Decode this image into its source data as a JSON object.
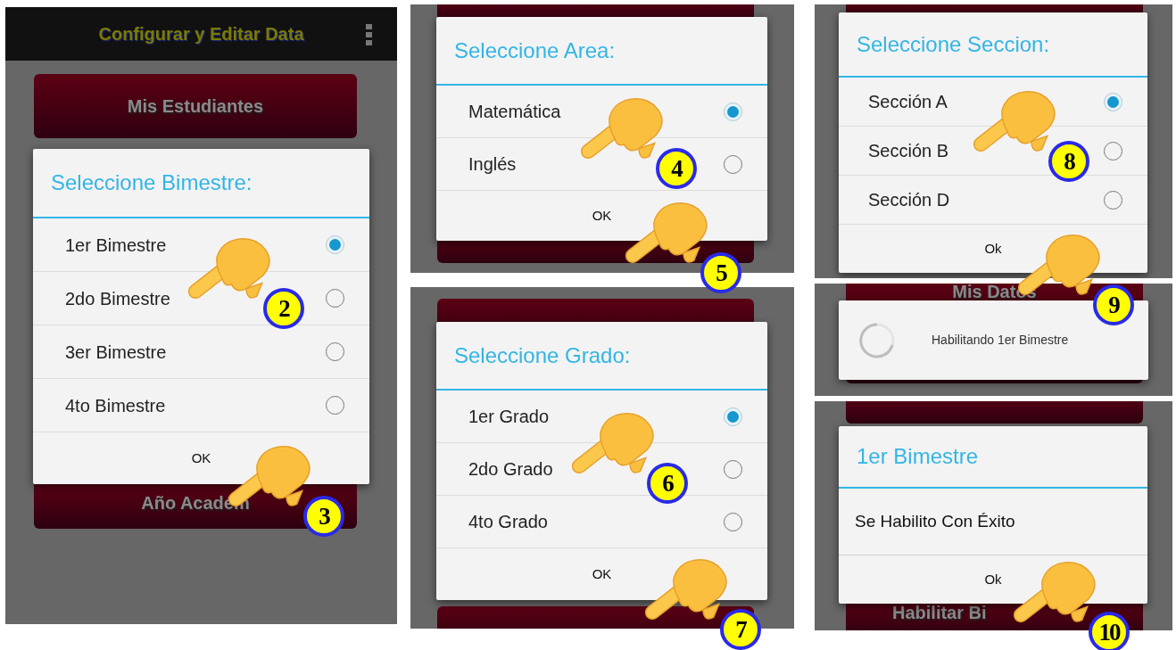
{
  "panels": [
    {
      "kind": "choice",
      "app_bar": {
        "title": "Configurar y Editar Data"
      },
      "backdrop": [
        {
          "label": "Mis Estudiantes"
        },
        {
          "label": "Año Académ"
        }
      ],
      "dialog": {
        "title": "Seleccione Bimestre:",
        "options": [
          {
            "label": "1er Bimestre",
            "selected": true
          },
          {
            "label": "2do Bimestre",
            "selected": false
          },
          {
            "label": "3er Bimestre",
            "selected": false
          },
          {
            "label": "4to Bimestre",
            "selected": false
          }
        ],
        "button": "OK"
      },
      "steps": [
        {
          "number": "2"
        },
        {
          "number": "3"
        }
      ]
    },
    {
      "kind": "choice",
      "dialog": {
        "title": "Seleccione Area:",
        "options": [
          {
            "label": "Matemática",
            "selected": true
          },
          {
            "label": "Inglés",
            "selected": false
          }
        ],
        "button": "OK"
      },
      "steps": [
        {
          "number": "4"
        },
        {
          "number": "5"
        }
      ]
    },
    {
      "kind": "choice",
      "dialog": {
        "title": "Seleccione Grado:",
        "options": [
          {
            "label": "1er Grado",
            "selected": true
          },
          {
            "label": "2do Grado",
            "selected": false
          },
          {
            "label": "4to Grado",
            "selected": false
          }
        ],
        "button": "OK"
      },
      "steps": [
        {
          "number": "6"
        },
        {
          "number": "7"
        }
      ]
    },
    {
      "kind": "choice",
      "dialog": {
        "title": "Seleccione Seccion:",
        "options": [
          {
            "label": "Sección A",
            "selected": true
          },
          {
            "label": "Sección B",
            "selected": false
          },
          {
            "label": "Sección D",
            "selected": false
          }
        ],
        "button": "Ok"
      },
      "steps": [
        {
          "number": "8"
        },
        {
          "number": "9"
        }
      ]
    },
    {
      "kind": "progress",
      "backdrop": [
        {
          "label": "Mis Datos"
        }
      ],
      "dialog": {
        "message": "Habilitando 1er Bimestre"
      }
    },
    {
      "kind": "message",
      "backdrop": [
        {
          "label": "Habilitar Bi"
        }
      ],
      "dialog": {
        "title": "1er Bimestre",
        "message": "Se Habilito Con Éxito",
        "button": "Ok"
      },
      "steps": [
        {
          "number": "10"
        }
      ]
    }
  ]
}
